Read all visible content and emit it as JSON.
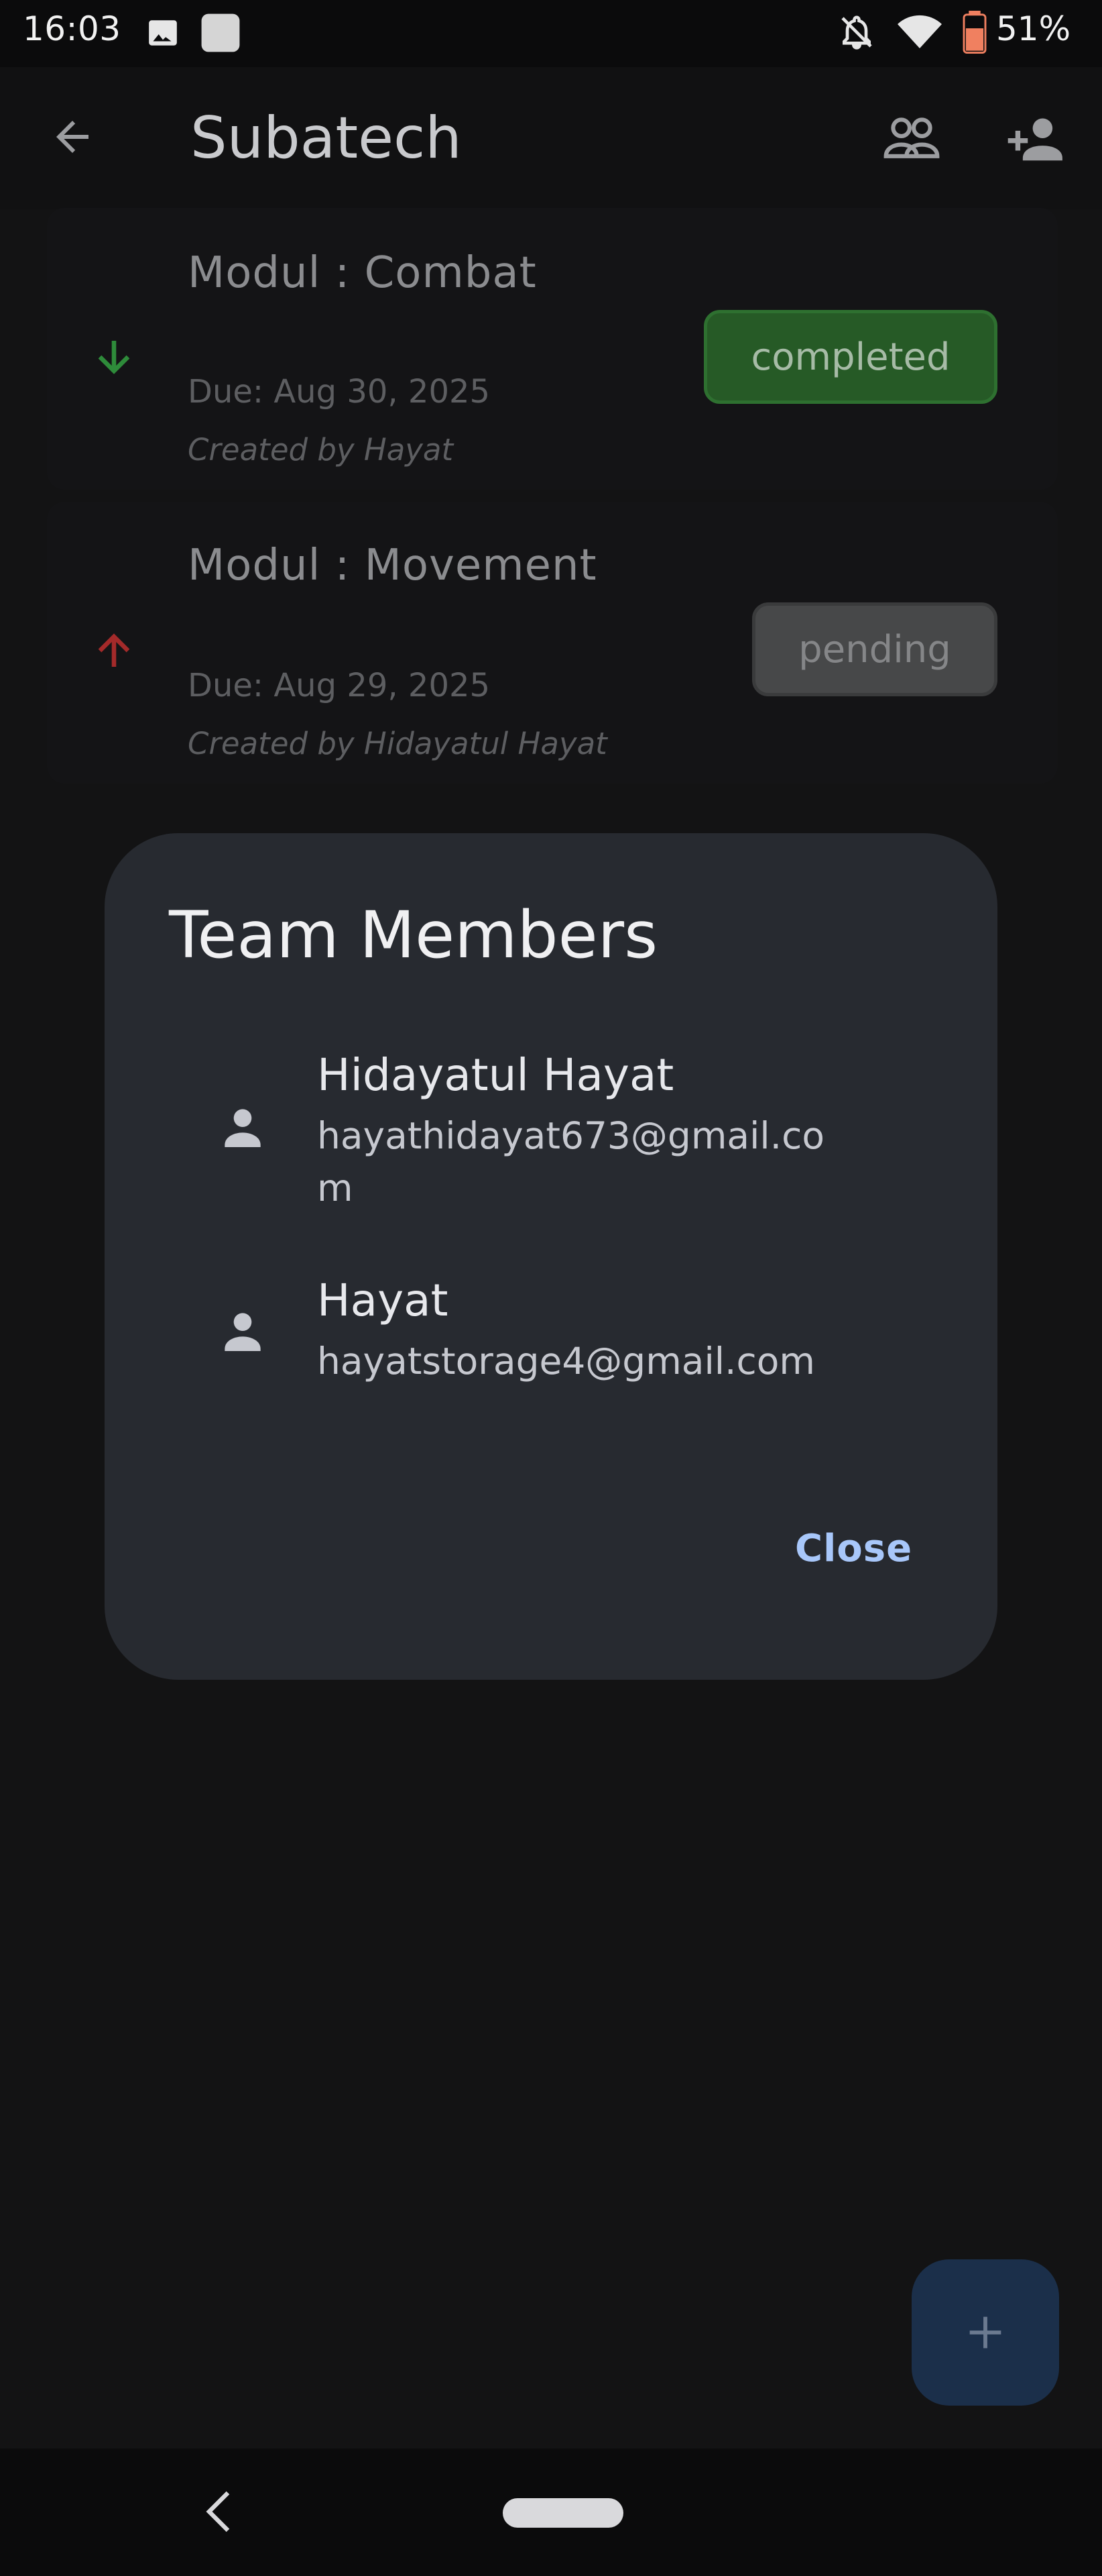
{
  "status_bar": {
    "time": "16:03",
    "battery_percent": "51%",
    "icons": [
      "image-icon",
      "app-square-icon",
      "bell-off-icon",
      "wifi-icon",
      "battery-icon"
    ]
  },
  "app_bar": {
    "title": "Subatech",
    "icons": [
      "back-arrow-icon",
      "team-icon",
      "add-member-icon"
    ]
  },
  "tasks": [
    {
      "title": "Modul : Combat",
      "due": "Due: Aug 30, 2025",
      "created": "Created by Hayat",
      "status": "completed",
      "priority_icon": "arrow-down-icon",
      "priority_color": "#2e8b3a"
    },
    {
      "title": "Modul : Movement",
      "due": "Due: Aug 29, 2025",
      "created": "Created by Hidayatul Hayat",
      "status": "pending",
      "priority_icon": "arrow-up-icon",
      "priority_color": "#a42a2a"
    }
  ],
  "dialog": {
    "title": "Team Members",
    "members": [
      {
        "name": "Hidayatul Hayat",
        "email_line1": "hayathidayat673@gmail.co",
        "email_line2": "m"
      },
      {
        "name": "Hayat",
        "email_line1": "hayatstorage4@gmail.com"
      }
    ],
    "close_label": "Close"
  },
  "fab": {
    "icon": "plus-icon"
  },
  "colors": {
    "accent": "#a8c7fa",
    "completed_bg": "#265a26",
    "pending_bg": "#474849",
    "dialog_bg": "#272a30"
  }
}
